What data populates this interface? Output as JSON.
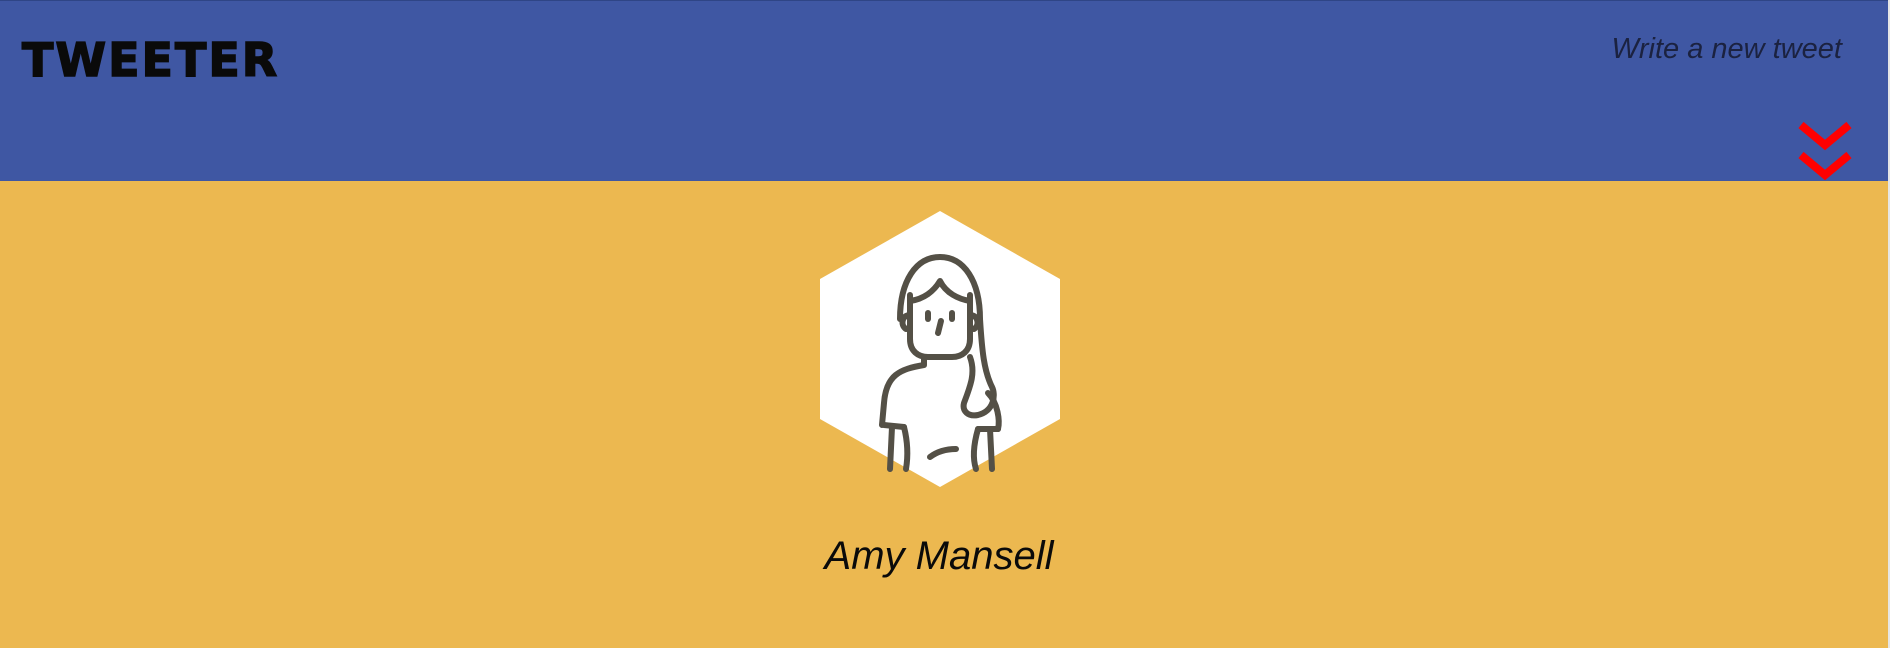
{
  "nav": {
    "logo": "TWEETER",
    "compose_label": "Write a new tweet",
    "toggle_icon": "double-chevron-down-icon",
    "toggle_color": "#ff0000"
  },
  "profile": {
    "avatar_icon": "woman-avatar-icon",
    "name": "Amy Mansell"
  },
  "colors": {
    "nav_background": "#3f57a3",
    "profile_background": "#ecb850",
    "hexagon": "#ffffff",
    "avatar_stroke": "#545046"
  }
}
